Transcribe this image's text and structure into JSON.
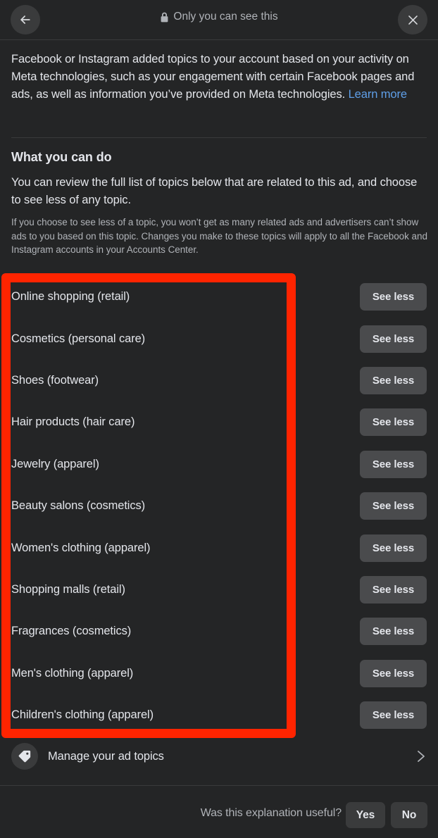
{
  "header": {
    "back_icon": "arrow-left-icon",
    "close_icon": "close-icon",
    "lock_icon": "lock-icon",
    "title": "Only you can see this"
  },
  "intro": {
    "text": "Facebook or Instagram added topics to your account based on your activity on Meta technologies, such as your engagement with certain Facebook pages and ads, as well as information you’ve provided on Meta technologies. ",
    "link_label": "Learn more"
  },
  "section": {
    "title": "What you can do",
    "body": "You can review the full list of topics below that are related to this ad, and choose to see less of any topic.",
    "note": "If you choose to see less of a topic, you won’t get as many related ads and advertisers can’t show ads to you based on this topic. Changes you make to these topics will apply to all the Facebook and Instagram accounts in your Accounts Center."
  },
  "topics": {
    "action_label": "See less",
    "items": [
      {
        "label": "Online shopping (retail)"
      },
      {
        "label": "Cosmetics (personal care)"
      },
      {
        "label": "Shoes (footwear)"
      },
      {
        "label": "Hair products (hair care)"
      },
      {
        "label": "Jewelry (apparel)"
      },
      {
        "label": "Beauty salons (cosmetics)"
      },
      {
        "label": "Women's clothing (apparel)"
      },
      {
        "label": "Shopping malls (retail)"
      },
      {
        "label": "Fragrances (cosmetics)"
      },
      {
        "label": "Men's clothing (apparel)"
      },
      {
        "label": "Children's clothing (apparel)"
      }
    ]
  },
  "manage": {
    "icon": "tag-icon",
    "label": "Manage your ad topics",
    "chevron_icon": "chevron-right-icon"
  },
  "footer": {
    "question": "Was this explanation useful?",
    "yes_label": "Yes",
    "no_label": "No"
  },
  "annotation": {
    "color": "#FF2400"
  },
  "colors": {
    "background": "#242526",
    "surface": "#3a3b3c",
    "button": "#4a4b4d",
    "text_primary": "#e4e6eb",
    "text_secondary": "#b0b3b8",
    "link": "#5f9fe8"
  }
}
